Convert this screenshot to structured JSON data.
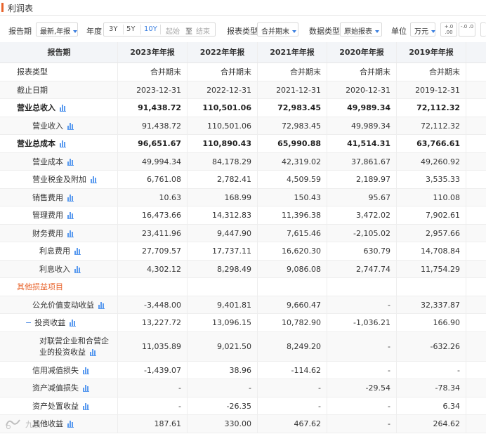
{
  "section_title": "利润表",
  "toolbar": {
    "report_period_label": "报告期",
    "report_period_value": "最新,年报",
    "year_label": "年度",
    "range_options": [
      "3Y",
      "5Y",
      "10Y"
    ],
    "active_range": "10Y",
    "start_placeholder": "起始",
    "to_text": "至",
    "end_placeholder": "结束",
    "statement_type_label": "报表类型",
    "statement_type_value": "合并期末",
    "data_type_label": "数据类型",
    "data_type_value": "原始报表",
    "unit_label": "单位",
    "unit_value": "万元",
    "decimal_more": "+.0 .00",
    "decimal_less": "-.0 .0"
  },
  "table": {
    "header": [
      "报告期",
      "2023年年报",
      "2022年年报",
      "2021年年报",
      "2020年年报",
      "2019年年报"
    ],
    "rows": [
      {
        "label": "报表类型",
        "values": [
          "合并期末",
          "合并期末",
          "合并期末",
          "合并期末",
          "合并期末"
        ]
      },
      {
        "label": "截止日期",
        "values": [
          "2023-12-31",
          "2022-12-31",
          "2021-12-31",
          "2020-12-31",
          "2019-12-31"
        ]
      },
      {
        "label": "营业总收入",
        "values": [
          "91,438.72",
          "110,501.06",
          "72,983.45",
          "49,989.34",
          "72,112.32"
        ]
      },
      {
        "label": "营业收入",
        "values": [
          "91,438.72",
          "110,501.06",
          "72,983.45",
          "49,989.34",
          "72,112.32"
        ]
      },
      {
        "label": "营业总成本",
        "values": [
          "96,651.67",
          "110,890.43",
          "65,990.88",
          "41,514.31",
          "63,766.61"
        ]
      },
      {
        "label": "营业成本",
        "values": [
          "49,994.34",
          "84,178.29",
          "42,319.02",
          "37,861.67",
          "49,260.92"
        ]
      },
      {
        "label": "营业税金及附加",
        "values": [
          "6,761.08",
          "2,782.41",
          "4,509.59",
          "2,189.97",
          "3,535.33"
        ]
      },
      {
        "label": "销售费用",
        "values": [
          "10.63",
          "168.99",
          "150.43",
          "95.67",
          "110.08"
        ]
      },
      {
        "label": "管理费用",
        "values": [
          "16,473.66",
          "14,312.83",
          "11,396.38",
          "3,472.02",
          "7,902.61"
        ]
      },
      {
        "label": "财务费用",
        "values": [
          "23,411.96",
          "9,447.90",
          "7,615.46",
          "-2,105.02",
          "2,957.66"
        ]
      },
      {
        "label": "利息费用",
        "values": [
          "27,709.57",
          "17,737.11",
          "16,620.30",
          "630.79",
          "14,708.84"
        ]
      },
      {
        "label": "利息收入",
        "values": [
          "4,302.12",
          "8,298.49",
          "9,086.08",
          "2,747.74",
          "11,754.29"
        ]
      },
      {
        "label": "其他损益项目",
        "values": [
          "",
          "",
          "",
          "",
          ""
        ]
      },
      {
        "label": "公允价值变动收益",
        "values": [
          "-3,448.00",
          "9,401.81",
          "9,660.47",
          "-",
          "32,337.87"
        ]
      },
      {
        "label": "投资收益",
        "values": [
          "13,227.72",
          "13,096.15",
          "10,782.90",
          "-1,036.21",
          "166.90"
        ]
      },
      {
        "label_line1": "对联营企业和合营企",
        "label_line2": "业的投资收益",
        "values": [
          "11,035.89",
          "9,021.50",
          "8,249.20",
          "-",
          "-632.26"
        ]
      },
      {
        "label": "信用减值损失",
        "values": [
          "-1,439.07",
          "38.96",
          "-114.62",
          "-",
          "-"
        ]
      },
      {
        "label": "资产减值损失",
        "values": [
          "-",
          "-",
          "-",
          "-29.54",
          "-78.34"
        ]
      },
      {
        "label": "资产处置收益",
        "values": [
          "-",
          "-26.35",
          "-",
          "-",
          "6.34"
        ]
      },
      {
        "label": "其他收益",
        "values": [
          "187.61",
          "330.00",
          "467.62",
          "-",
          "264.62"
        ]
      }
    ]
  },
  "watermark": "九股"
}
